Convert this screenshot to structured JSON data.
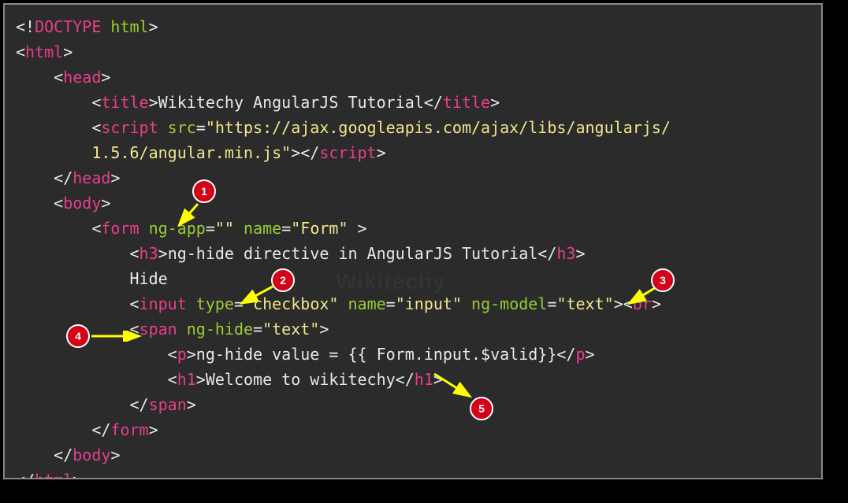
{
  "code": {
    "l1a": "<!",
    "l1b": "DOCTYPE",
    "l1c": " html",
    "l1d": ">",
    "l2a": "<",
    "l2b": "html",
    "l2c": ">",
    "l3a": "<",
    "l3b": "head",
    "l3c": ">",
    "l4a": "<",
    "l4b": "title",
    "l4c": ">",
    "l4d": "Wikitechy AngularJS Tutorial",
    "l4e": "</",
    "l4f": "title",
    "l4g": ">",
    "l5a": "<",
    "l5b": "script",
    "l5c": " src",
    "l5d": "=",
    "l5e": "\"https://ajax.googleapis.com/ajax/libs/angularjs/",
    "l6a": "1.5.6/angular.min.js\"",
    "l6b": "></",
    "l6c": "script",
    "l6d": ">",
    "l7a": "</",
    "l7b": "head",
    "l7c": ">",
    "l8a": "<",
    "l8b": "body",
    "l8c": ">",
    "l9a": "<",
    "l9b": "form",
    "l9c": " ng-app",
    "l9d": "=",
    "l9e": "\"\"",
    "l9f": " name",
    "l9g": "=",
    "l9h": "\"Form\"",
    "l9i": " >",
    "l10a": "<",
    "l10b": "h3",
    "l10c": ">",
    "l10d": "ng-hide directive in AngularJS Tutorial",
    "l10e": "</",
    "l10f": "h3",
    "l10g": ">",
    "l11a": "Hide",
    "l12a": "<",
    "l12b": "input",
    "l12c": " type",
    "l12d": "=",
    "l12e": "\"checkbox\"",
    "l12f": " name",
    "l12g": "=",
    "l12h": "\"input\"",
    "l12i": " ng-model",
    "l12j": "=",
    "l12k": "\"text\"",
    "l12l": "><",
    "l12m": "br",
    "l12n": ">",
    "l13a": "<",
    "l13b": "span",
    "l13c": " ng-hide",
    "l13d": "=",
    "l13e": "\"text\"",
    "l13f": ">",
    "l14a": "<",
    "l14b": "p",
    "l14c": ">",
    "l14d": "ng-hide value = {{ Form.input.$valid}}",
    "l14e": "</",
    "l14f": "p",
    "l14g": ">",
    "l15a": "<",
    "l15b": "h1",
    "l15c": ">",
    "l15d": "Welcome to wikitechy",
    "l15e": "</",
    "l15f": "h1",
    "l15g": ">",
    "l16a": "</",
    "l16b": "span",
    "l16c": ">",
    "l17a": "</",
    "l17b": "form",
    "l17c": ">",
    "l18a": "</",
    "l18b": "body",
    "l18c": ">",
    "l19a": "</",
    "l19b": "html",
    "l19c": ">"
  },
  "badges": {
    "b1": "1",
    "b2": "2",
    "b3": "3",
    "b4": "4",
    "b5": "5"
  },
  "watermark": "Wikitechy"
}
